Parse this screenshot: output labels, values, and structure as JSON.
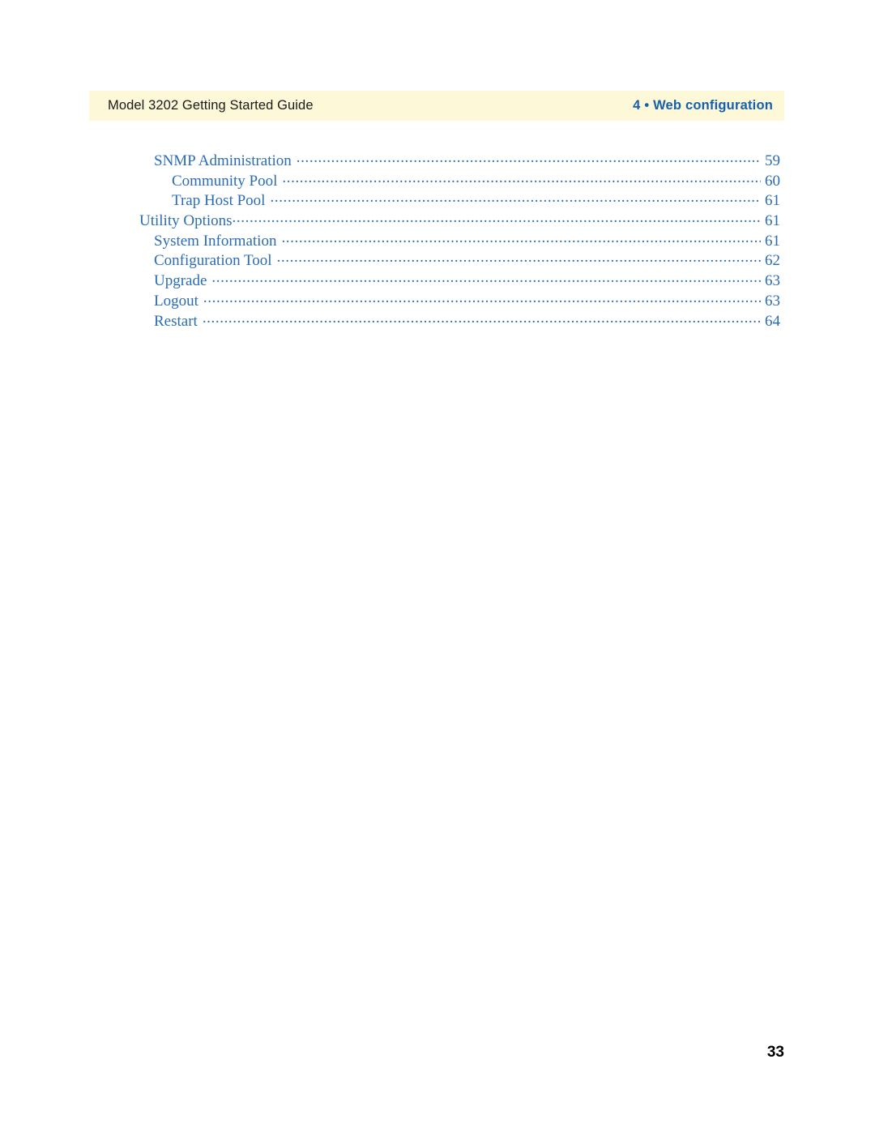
{
  "header": {
    "left_text": "Model 3202 Getting Started Guide",
    "right_text": "4 • Web configuration",
    "band_color": "#fdf8d8",
    "right_text_color": "#1560ad"
  },
  "toc": {
    "text_color": "#2b6cb3",
    "entries": [
      {
        "title": "SNMP Administration",
        "page": "59",
        "level": 2,
        "gap_before_dots": true
      },
      {
        "title": "Community Pool",
        "page": "60",
        "level": 3,
        "gap_before_dots": true
      },
      {
        "title": "Trap Host Pool",
        "page": "61",
        "level": 3,
        "gap_before_dots": true
      },
      {
        "title": "Utility Options",
        "page": "61",
        "level": 1,
        "gap_before_dots": false
      },
      {
        "title": "System Information",
        "page": "61",
        "level": 2,
        "gap_before_dots": true
      },
      {
        "title": "Configuration Tool",
        "page": "62",
        "level": 2,
        "gap_before_dots": true
      },
      {
        "title": "Upgrade",
        "page": "63",
        "level": 2,
        "gap_before_dots": true
      },
      {
        "title": "Logout",
        "page": "63",
        "level": 2,
        "gap_before_dots": true
      },
      {
        "title": "Restart",
        "page": "64",
        "level": 2,
        "gap_before_dots": true
      }
    ]
  },
  "folio": {
    "page_number": "33"
  }
}
